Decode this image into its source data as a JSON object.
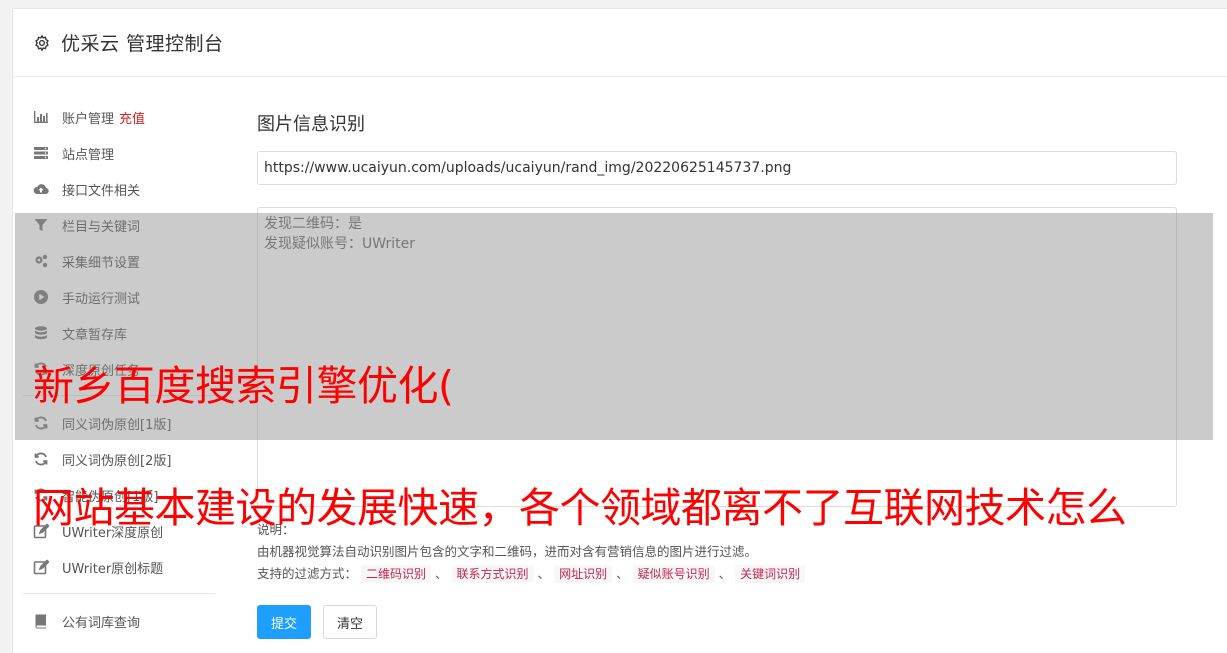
{
  "header": {
    "title": "优采云 管理控制台",
    "icon": "gear-icon"
  },
  "sidebar": {
    "items": [
      {
        "label": "账户管理",
        "badge": "充值",
        "icon": "bar-chart-icon"
      },
      {
        "label": "站点管理",
        "icon": "server-icon"
      },
      {
        "label": "接口文件相关",
        "icon": "cloud-upload-icon"
      },
      {
        "label": "栏目与关键词",
        "icon": "filter-icon"
      },
      {
        "label": "采集细节设置",
        "icon": "cogs-icon"
      },
      {
        "label": "手动运行测试",
        "icon": "play-circle-icon"
      },
      {
        "label": "文章暂存库",
        "icon": "database-icon"
      },
      {
        "label": "深度原创任务",
        "icon": "refresh-icon"
      },
      {
        "label": "同义词伪原创[1版]",
        "icon": "refresh-icon"
      },
      {
        "label": "同义词伪原创[2版]",
        "icon": "refresh-icon"
      },
      {
        "label": "智能伪原创[1版]",
        "icon": "refresh-icon"
      },
      {
        "label": "UWriter深度原创",
        "icon": "edit-icon"
      },
      {
        "label": "UWriter原创标题",
        "icon": "edit-icon"
      },
      {
        "label": "公有词库查询",
        "icon": "book-icon"
      }
    ]
  },
  "main": {
    "heading": "图片信息识别",
    "url_value": "https://www.ucaiyun.com/uploads/ucaiyun/rand_img/20220625145737.png",
    "result_line1": "发现二维码：是",
    "result_line2": "发现疑似账号：UWriter",
    "desc_label": "说明：",
    "desc_text": "由机器视觉算法自动识别图片包含的文字和二维码，进而对含有营销信息的图片进行过滤。",
    "filters_label": "支持的过滤方式：",
    "filters": [
      "二维码识别",
      "联系方式识别",
      "网址识别",
      "疑似账号识别",
      "关键词识别"
    ],
    "separator": "、",
    "submit_label": "提交",
    "clear_label": "清空"
  },
  "overlay": {
    "line1": "新乡百度搜索引擎优化(",
    "line2": "网站基本建设的发展快速，各个领域都离不了互联网技术怎么"
  },
  "colors": {
    "accent": "#1e9fff",
    "recharge": "#e02020",
    "overlay_text": "#ff0000",
    "tag_text": "#c7254e"
  }
}
